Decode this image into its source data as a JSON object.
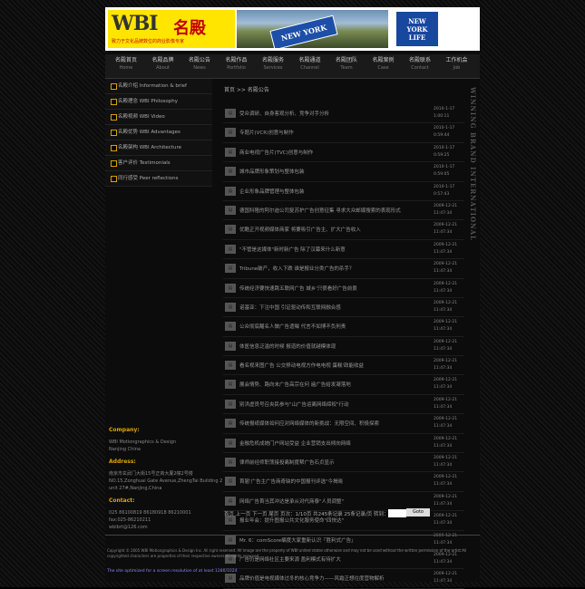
{
  "banner": {
    "logo_mark": "WBI",
    "logo_cn": "名殿",
    "logo_slogan": "致力于文化品牌数位的商业影像专家",
    "photo_sign": "NEW YORK",
    "ad_text": "NEW\nYORK\nLIFE"
  },
  "nav": [
    {
      "cn": "名殿首页",
      "en": "Home"
    },
    {
      "cn": "名殿品牌",
      "en": "About"
    },
    {
      "cn": "名殿公告",
      "en": "News"
    },
    {
      "cn": "名殿作品",
      "en": "Portfolio"
    },
    {
      "cn": "名殿服务",
      "en": "Services"
    },
    {
      "cn": "名殿通道",
      "en": "Channel"
    },
    {
      "cn": "名殿团队",
      "en": "Team"
    },
    {
      "cn": "名殿案例",
      "en": "Case"
    },
    {
      "cn": "名殿联系",
      "en": "Contact"
    },
    {
      "cn": "工作机会",
      "en": "Job"
    }
  ],
  "sidebar": [
    "名殿介绍 Information & brief",
    "名殿理念 WBI Philosophy",
    "名殿视频 WBI Video",
    "名殿优势 WBI Advantages",
    "名殿架构 WBI Architecture",
    "客户评价 Testimonials",
    "同行感受 Peer reflections"
  ],
  "company": {
    "company_head": "Company:",
    "company_text": "WBI Motiongraphics & Design\nNanjing China",
    "address_head": "Address:",
    "address_text": "南京市玄武门大街15号正商大厦2幢2号楼\nNO.15,Zonghuai Gate Avenue,ZhengTai Building 2\nunit 27#,Nanjing,China",
    "contact_head": "Contact:",
    "contact_text": "025 86100819 86180918 86210001\nfax:025-86210211\nwbibrt@126.com"
  },
  "breadcrumb": "首页 >> 名殿公告",
  "news": [
    {
      "title": "受众调研、自身客观分析、竞争对手分析",
      "date": "2010-1-17\n1:00:11"
    },
    {
      "title": "专题片(VCR)创意与制作",
      "date": "2010-1-17\n0:59:44"
    },
    {
      "title": "商业电视广告片(TVC)创意与制作",
      "date": "2010-1-17\n0:59:25"
    },
    {
      "title": "城市品牌形象策划与整体包装",
      "date": "2010-1-17\n0:59:05"
    },
    {
      "title": "企业形象品牌管理与整体包装",
      "date": "2010-1-17\n0:57:43"
    },
    {
      "title": "德国科隆的阿尔迪公司复苏护广告创意征集 寻求大众邮媒搜索的表现形式",
      "date": "2009-12-21\n11:47:34"
    },
    {
      "title": "优酷正开视频媒体商家 将要吸引广告主、扩大广告收入",
      "date": "2009-12-21\n11:47:34"
    },
    {
      "title": "\"不管是这媒体\"新时新广告 除了汉幕来什么新意",
      "date": "2009-12-21\n11:47:34"
    },
    {
      "title": "Tribune破产，收入下跌 谁是报业分类广告的杀手？",
      "date": "2009-12-21\n11:47:34"
    },
    {
      "title": "传统经济要快速跳五联网广告 城乡'只很看好广告前景",
      "date": "2009-12-21\n11:47:34"
    },
    {
      "title": "诺基亚：下注中国 引证驱动传和互联网融合感",
      "date": "2009-12-21\n11:47:34"
    },
    {
      "title": "公众彻底醒名人做广告遗嘱 代言不如博不负刑责",
      "date": "2009-12-21\n11:47:34"
    },
    {
      "title": "体医信息泛滥的时候 报道的价值就越模体现",
      "date": "2009-12-21\n11:47:34"
    },
    {
      "title": "看名视来图广告 公交移动电视方作电电视 蛋糕'政能收益",
      "date": "2009-12-21\n11:47:34"
    },
    {
      "title": "展会情势、路向未广告高宗在何 遍广告给发凝落地",
      "date": "2009-12-21\n11:47:34"
    },
    {
      "title": "别洪虚员号召央民参与\"山广告运离网络缔权\"行动",
      "date": "2009-12-21\n11:47:34"
    },
    {
      "title": "传统报纸媒体如何应对网络媒体的新挑战：无限空间、积极探索",
      "date": "2009-12-21\n11:47:34"
    },
    {
      "title": "金融危机成她门户网站受益 企业营销支出倾向网络",
      "date": "2009-12-21\n11:47:34"
    },
    {
      "title": "律师前经师职荡接投离制度帮广告石贞显示",
      "date": "2009-12-21\n11:47:34"
    },
    {
      "title": "首届'广告主广告商奇缺的中国报刊评选\"今揭晓",
      "date": "2009-12-21\n11:47:34"
    },
    {
      "title": "网络广告首当其冲达是承从对代商泰\"人员调整\"",
      "date": "2009-12-21\n11:47:34"
    },
    {
      "title": "报业年会：提升图报公共文化服务使命\"四快达\"",
      "date": "2009-12-21\n11:47:34"
    },
    {
      "title": "Mr. 6：comScore编度大家重新认识「胜利式广告」",
      "date": "2009-12-21\n11:47:34"
    },
    {
      "title": "广告仍是网络社区主要来源 盈利模式有待扩大",
      "date": "2009-12-21\n11:47:34"
    },
    {
      "title": "品牌价值是电视媒体过冬的核心竞争力——风霜正想往度营物解析",
      "date": "2009-12-21\n11:47:34"
    }
  ],
  "pager": {
    "text": "首页 上一页 下一页 尾页 页次：1/10页 共245条记录 25条记录/页 转到：",
    "goto_label": "Goto"
  },
  "footer": {
    "copyright": "Copyright © 2005 WBI Motiongraphics & Design Inc. All right reserved. All image are the property of WBI united states otherwise and may not be used without the written permission of the artist.All copyrighted characters are properties of their respective owners.All rights reserved.",
    "resolution": "The site optimized for a screen resolution of at least 1280/1024"
  },
  "vertical_text": "WINNING BRAND INTERNATIONAL",
  "colors": {
    "accent": "#e8a000",
    "nav_bg": "#1a1a1a",
    "page_bg": "#0c0c0c"
  }
}
